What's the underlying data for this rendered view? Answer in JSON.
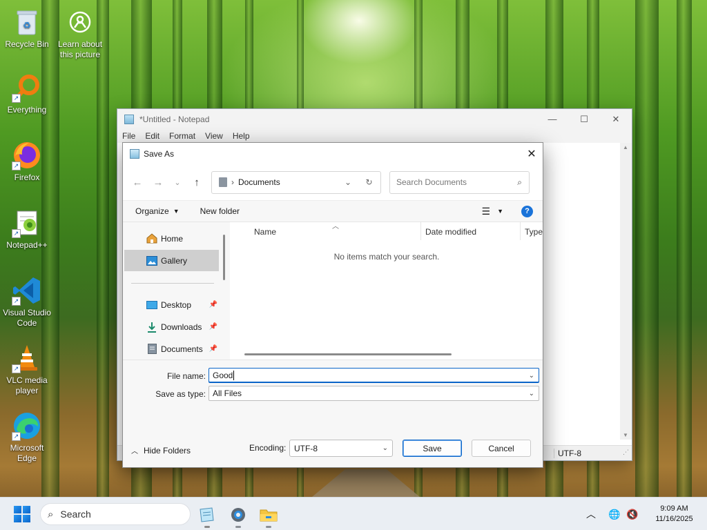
{
  "desktop": {
    "icons": [
      {
        "label": "Recycle Bin"
      },
      {
        "label": "Learn about this picture"
      },
      {
        "label": "Everything"
      },
      {
        "label": "Firefox"
      },
      {
        "label": "Notepad++"
      },
      {
        "label": "Visual Studio Code"
      },
      {
        "label": "VLC media player"
      },
      {
        "label": "Microsoft Edge"
      }
    ]
  },
  "notepad": {
    "title": "*Untitled - Notepad",
    "menu": [
      "File",
      "Edit",
      "Format",
      "View",
      "Help"
    ],
    "status_encoding": "UTF-8",
    "caption_icons": [
      "minimize-icon",
      "maximize-icon",
      "close-icon"
    ]
  },
  "save_dialog": {
    "title": "Save As",
    "address": {
      "crumb": "Documents"
    },
    "search_placeholder": "Search Documents",
    "toolbar": {
      "organize": "Organize",
      "new_folder": "New folder"
    },
    "nav": [
      {
        "label": "Home",
        "icon": "home-icon"
      },
      {
        "label": "Gallery",
        "icon": "gallery-icon",
        "selected": true
      },
      {
        "label": "Desktop",
        "icon": "desktop-icon",
        "pinned": true
      },
      {
        "label": "Downloads",
        "icon": "download-icon",
        "pinned": true
      },
      {
        "label": "Documents",
        "icon": "documents-icon",
        "pinned": true
      }
    ],
    "columns": [
      "Name",
      "Date modified",
      "Type"
    ],
    "empty_message": "No items match your search.",
    "file_name_label": "File name:",
    "file_name_value": "Good",
    "save_as_type_label": "Save as type:",
    "save_as_type_value": "All Files",
    "hide_folders": "Hide Folders",
    "encoding_label": "Encoding:",
    "encoding_value": "UTF-8",
    "save_button": "Save",
    "cancel_button": "Cancel"
  },
  "taskbar": {
    "search_label": "Search",
    "time": "9:09 AM",
    "date": "11/16/2025"
  },
  "colors": {
    "accent": "#0a64c8",
    "selection": "#cfcfcf",
    "taskbar": "#eaeef3"
  }
}
